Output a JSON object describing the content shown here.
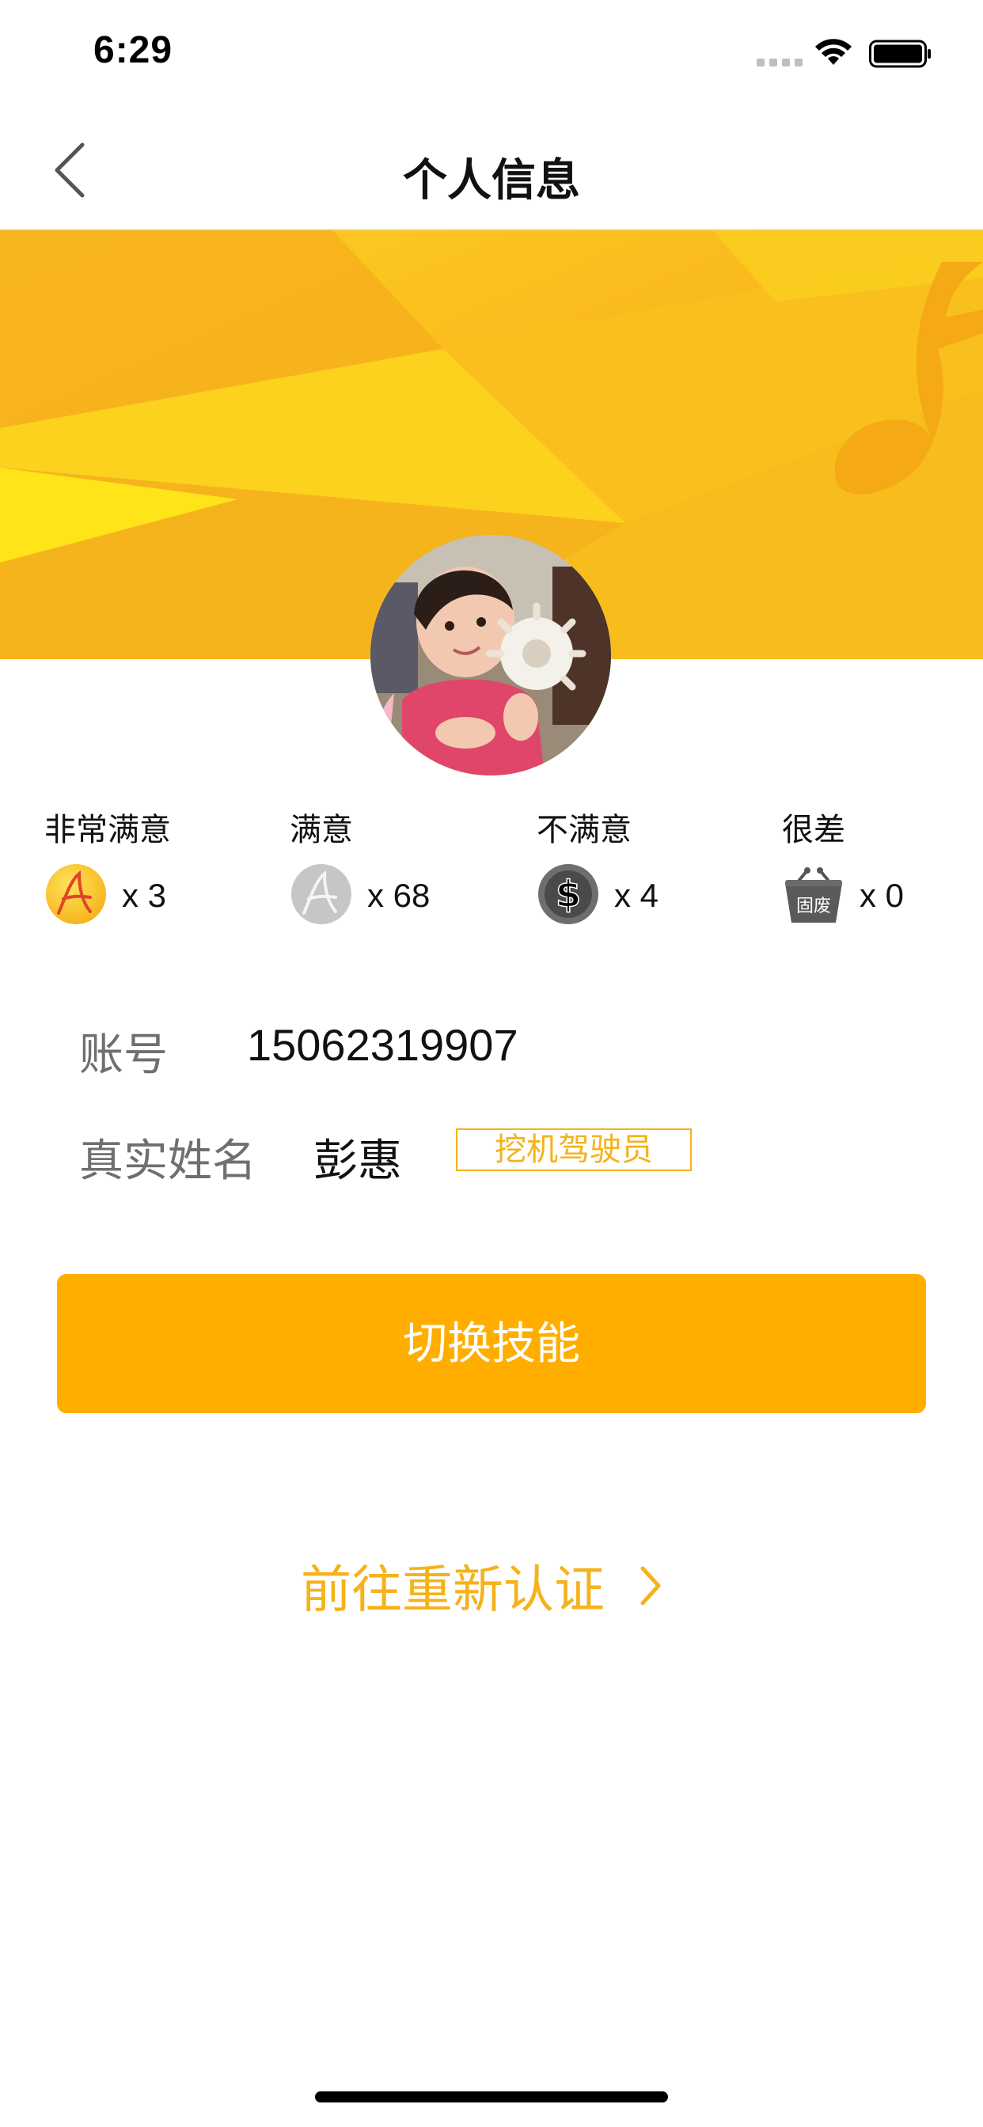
{
  "status_bar": {
    "time": "6:29"
  },
  "nav": {
    "title": "个人信息"
  },
  "ratings": [
    {
      "label": "非常满意",
      "count": "x 3",
      "icon": "gold-a-badge-icon"
    },
    {
      "label": "满意",
      "count": "x 68",
      "icon": "silver-a-badge-icon"
    },
    {
      "label": "不满意",
      "count": "x 4",
      "icon": "dollar-badge-icon"
    },
    {
      "label": "很差",
      "count": "x 0",
      "icon": "waste-basket-icon",
      "icon_text": "固废"
    }
  ],
  "profile": {
    "account_label": "账号",
    "account_value": "15062319907",
    "name_label": "真实姓名",
    "name_value": "彭惠",
    "skill_tag": "挖机驾驶员"
  },
  "actions": {
    "switch_skill": "切换技能",
    "reverify": "前往重新认证"
  },
  "colors": {
    "accent": "#FFAE00",
    "accent_text": "#F5B21A",
    "banner_yellow": "#FFD21A"
  }
}
